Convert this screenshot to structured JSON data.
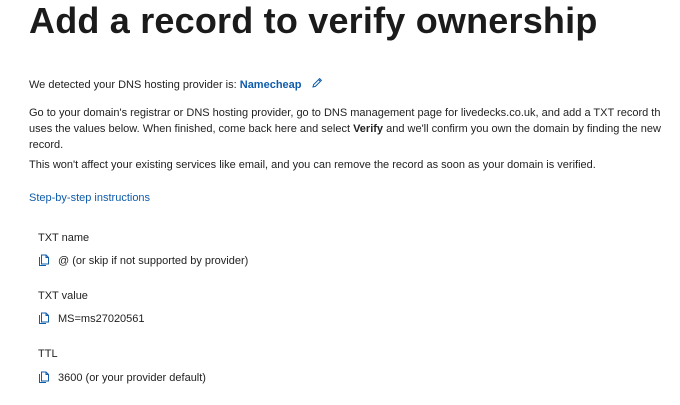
{
  "title": "Add a record to verify ownership",
  "detected": {
    "prefix": "We detected your DNS hosting provider is:",
    "provider": "Namecheap"
  },
  "instructions": {
    "line1": "Go to your domain's registrar or DNS hosting provider, go to DNS management page for livedecks.co.uk, and add a TXT record th",
    "line2_part1": "uses the values below. When finished, come back here and select ",
    "line2_bold": "Verify",
    "line2_part2": " and we'll confirm you own the domain by finding the new",
    "line3": "record."
  },
  "no_affect": "This won't affect your existing services like email, and you can remove the record as soon as your domain is verified.",
  "step_link": "Step-by-step instructions",
  "fields": [
    {
      "label": "TXT name",
      "value": "@ (or skip if not supported by provider)"
    },
    {
      "label": "TXT value",
      "value": "MS=ms27020561"
    },
    {
      "label": "TTL",
      "value": "3600 (or your provider default)"
    }
  ],
  "colors": {
    "link": "#0f5cab",
    "text": "#1b1b1b"
  },
  "icons": {
    "edit": "pencil-icon",
    "copy": "copy-icon"
  }
}
